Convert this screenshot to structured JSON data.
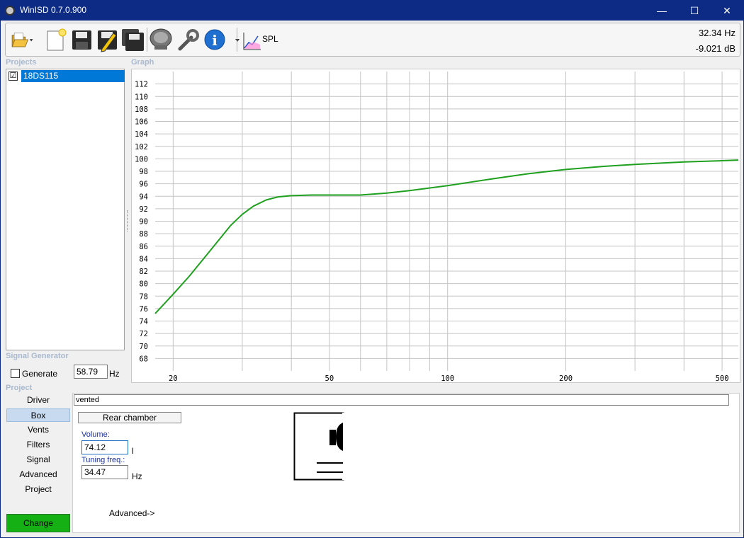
{
  "window": {
    "title": "WinISD 0.7.0.900",
    "controls": {
      "minimize": "—",
      "maximize": "☐",
      "close": "✕"
    }
  },
  "toolbar": {
    "buttons": [
      "open-icon",
      "new-project-icon",
      "save-icon",
      "edit-save-icon",
      "save-all-icon",
      "driver-icon",
      "tools-icon",
      "info-icon",
      "spl-graph-icon"
    ],
    "spl_label": "SPL",
    "readout_hz": "32.34 Hz",
    "readout_db": "-9.021 dB"
  },
  "projects": {
    "label": "Projects",
    "items": [
      {
        "name": "18DS115",
        "checked": "☑"
      }
    ]
  },
  "graph": {
    "label": "Graph"
  },
  "signal_generator": {
    "label": "Signal Generator",
    "generate_label": "Generate",
    "frequency": "58.79",
    "unit": "Hz"
  },
  "project": {
    "label": "Project",
    "nav": [
      "Driver",
      "Box",
      "Vents",
      "Filters",
      "Signal",
      "Advanced",
      "Project"
    ],
    "active_nav": "Box",
    "change_label": "Change"
  },
  "box": {
    "type": "vented",
    "rear_chamber_label": "Rear chamber",
    "volume_label": "Volume:",
    "volume_value": "74.12",
    "volume_unit": "l",
    "tuning_label": "Tuning freq.:",
    "tuning_value": "34.47",
    "tuning_unit": "Hz",
    "advanced_label": "Advanced->"
  },
  "chart_data": {
    "type": "line",
    "title": "",
    "xlabel": "",
    "ylabel": "",
    "xscale": "log",
    "xlim": [
      18,
      550
    ],
    "ylim": [
      66,
      114
    ],
    "x_ticks": [
      20,
      50,
      100,
      200,
      500
    ],
    "y_ticks": [
      68,
      70,
      72,
      74,
      76,
      78,
      80,
      82,
      84,
      86,
      88,
      90,
      92,
      94,
      96,
      98,
      100,
      102,
      104,
      106,
      108,
      110,
      112
    ],
    "grid": true,
    "legend": "none",
    "series": [
      {
        "color": "#1fa01f",
        "x": [
          18,
          20,
          22,
          25,
          28,
          30,
          32,
          34.5,
          37,
          40,
          45,
          50,
          60,
          70,
          80,
          100,
          130,
          160,
          200,
          250,
          300,
          400,
          500,
          550
        ],
        "y": [
          75.2,
          78.3,
          81.2,
          85.5,
          89.3,
          91.1,
          92.4,
          93.4,
          93.9,
          94.1,
          94.2,
          94.2,
          94.2,
          94.5,
          94.9,
          95.7,
          96.8,
          97.6,
          98.3,
          98.8,
          99.1,
          99.5,
          99.7,
          99.8
        ]
      }
    ]
  }
}
